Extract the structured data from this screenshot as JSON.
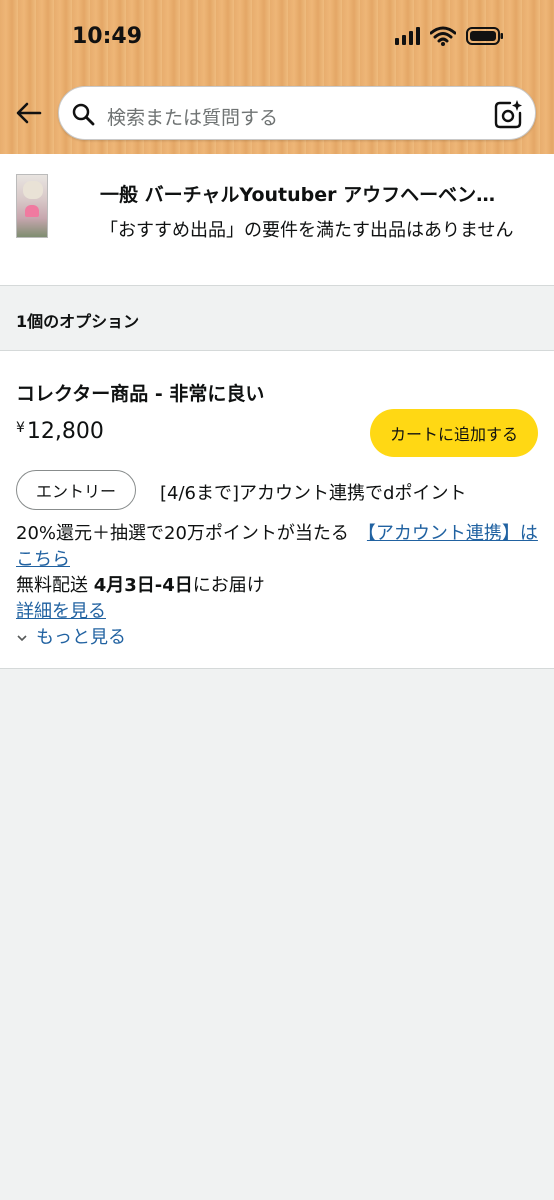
{
  "status_bar": {
    "time": "10:49"
  },
  "search": {
    "placeholder": "検索または質問する"
  },
  "product": {
    "title": "一般 バーチャルYoutuber アウフヘーベン…",
    "note": "「おすすめ出品」の要件を満たす出品はありません"
  },
  "options_header": "1個のオプション",
  "offer": {
    "condition": "コレクター商品 - 非常に良い",
    "currency": "¥",
    "price": "12,800",
    "cart_button": "カートに追加する",
    "entry_button": "エントリー",
    "promo_line1": "[4/6まで]アカウント連携でdポイント",
    "promo_line2": "20%還元＋抽選で20万ポイントが当たる",
    "promo_link": "【アカウント連携】はこちら",
    "delivery_prefix": "無料配送 ",
    "delivery_date": "4月3日-4日",
    "delivery_suffix": "にお届け",
    "details_link": "詳細を見る",
    "see_more": "もっと見る"
  },
  "colors": {
    "cart_button": "#ffd814",
    "link": "#2162a1",
    "header": "#eeb677"
  },
  "icons": [
    "back-arrow-icon",
    "search-icon",
    "camera-sparkle-icon",
    "chevron-down-icon",
    "signal-icon",
    "wifi-icon",
    "battery-icon"
  ]
}
